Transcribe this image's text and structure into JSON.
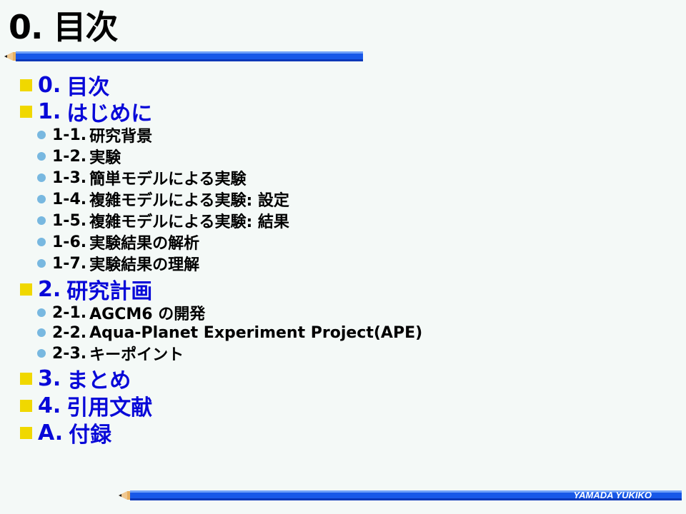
{
  "slide": {
    "title": "0. 目次",
    "author": "YAMADA YUKIKO"
  },
  "outline": {
    "items": [
      {
        "level": 1,
        "number": "0.",
        "label": "目次"
      },
      {
        "level": 1,
        "number": "1.",
        "label": "はじめに"
      },
      {
        "level": 2,
        "number": "1-1.",
        "label": "研究背景"
      },
      {
        "level": 2,
        "number": "1-2.",
        "label": "実験"
      },
      {
        "level": 2,
        "number": "1-3.",
        "label": "簡単モデルによる実験"
      },
      {
        "level": 2,
        "number": "1-4.",
        "label": "複雑モデルによる実験: 設定"
      },
      {
        "level": 2,
        "number": "1-5.",
        "label": "複雑モデルによる実験: 結果"
      },
      {
        "level": 2,
        "number": "1-6.",
        "label": "実験結果の解析"
      },
      {
        "level": 2,
        "number": "1-7.",
        "label": "実験結果の理解"
      },
      {
        "level": 1,
        "number": "2.",
        "label": "研究計画"
      },
      {
        "level": 2,
        "number": "2-1.",
        "label": "AGCM6 の開発"
      },
      {
        "level": 2,
        "number": "2-2.",
        "label": "Aqua-Planet Experiment Project(APE)"
      },
      {
        "level": 2,
        "number": "2-3.",
        "label": "キーポイント"
      },
      {
        "level": 1,
        "number": "3.",
        "label": "まとめ"
      },
      {
        "level": 1,
        "number": "4.",
        "label": "引用文献"
      },
      {
        "level": 1,
        "number": "A.",
        "label": "付録"
      }
    ]
  },
  "colors": {
    "heading_blue": "#0808d8",
    "bullet_square": "#f0d800",
    "bullet_dot": "#78b8e0",
    "bar_blue": "#1858e8"
  }
}
